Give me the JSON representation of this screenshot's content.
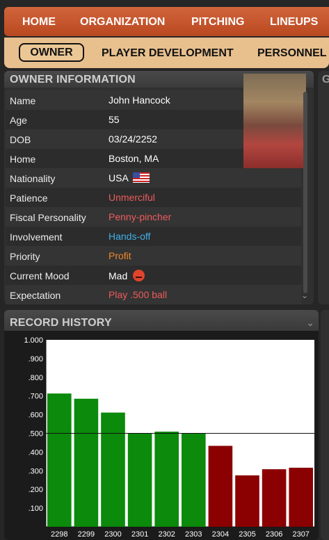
{
  "nav": {
    "top": [
      "HOME",
      "ORGANIZATION",
      "PITCHING",
      "LINEUPS"
    ],
    "sub": [
      "OWNER",
      "PLAYER DEVELOPMENT",
      "PERSONNEL"
    ],
    "active_sub": "OWNER"
  },
  "owner_info": {
    "title": "OWNER INFORMATION",
    "rows": [
      {
        "label": "Name",
        "value": "John Hancock",
        "color": "#ffffff"
      },
      {
        "label": "Age",
        "value": "55",
        "color": "#ffffff"
      },
      {
        "label": "DOB",
        "value": "03/24/2252",
        "color": "#ffffff"
      },
      {
        "label": "Home",
        "value": "Boston, MA",
        "color": "#ffffff"
      },
      {
        "label": "Nationality",
        "value": "USA",
        "color": "#ffffff",
        "icon": "us-flag-icon"
      },
      {
        "label": "Patience",
        "value": "Unmerciful",
        "color": "#ee5b5b"
      },
      {
        "label": "Fiscal Personality",
        "value": "Penny-pincher",
        "color": "#ee5b5b"
      },
      {
        "label": "Involvement",
        "value": "Hands-off",
        "color": "#3fb0e8"
      },
      {
        "label": "Priority",
        "value": "Profit",
        "color": "#f0882a"
      },
      {
        "label": "Current Mood",
        "value": "Mad",
        "color": "#ffffff",
        "icon": "angry-face-icon"
      },
      {
        "label": "Expectation",
        "value": "Play .500 ball",
        "color": "#ee5b5b"
      }
    ]
  },
  "side_panel": {
    "title": "G"
  },
  "record_history": {
    "title": "RECORD HISTORY"
  },
  "chart_data": {
    "type": "bar",
    "categories": [
      "2298",
      "2299",
      "2300",
      "2301",
      "2302",
      "2303",
      "2304",
      "2305",
      "2306",
      "2307"
    ],
    "values": [
      0.713,
      0.685,
      0.611,
      0.5,
      0.509,
      0.5,
      0.433,
      0.275,
      0.308,
      0.316
    ],
    "value_labels": [
      ".713",
      ".685",
      ".611",
      ".500",
      ".509",
      ".500",
      ".433",
      ".275",
      ".308",
      ".316"
    ],
    "bar_colors": [
      "#0b8a0b",
      "#0b8a0b",
      "#0b8a0b",
      "#0b8a0b",
      "#0b8a0b",
      "#0b8a0b",
      "#8b0000",
      "#8b0000",
      "#8b0000",
      "#8b0000"
    ],
    "yticks": [
      "1.000",
      ".900",
      ".800",
      ".700",
      ".600",
      ".500",
      ".400",
      ".300",
      ".200",
      ".100"
    ],
    "ylim": [
      0,
      1.0
    ],
    "reference_line": 0.5,
    "grid": false
  }
}
